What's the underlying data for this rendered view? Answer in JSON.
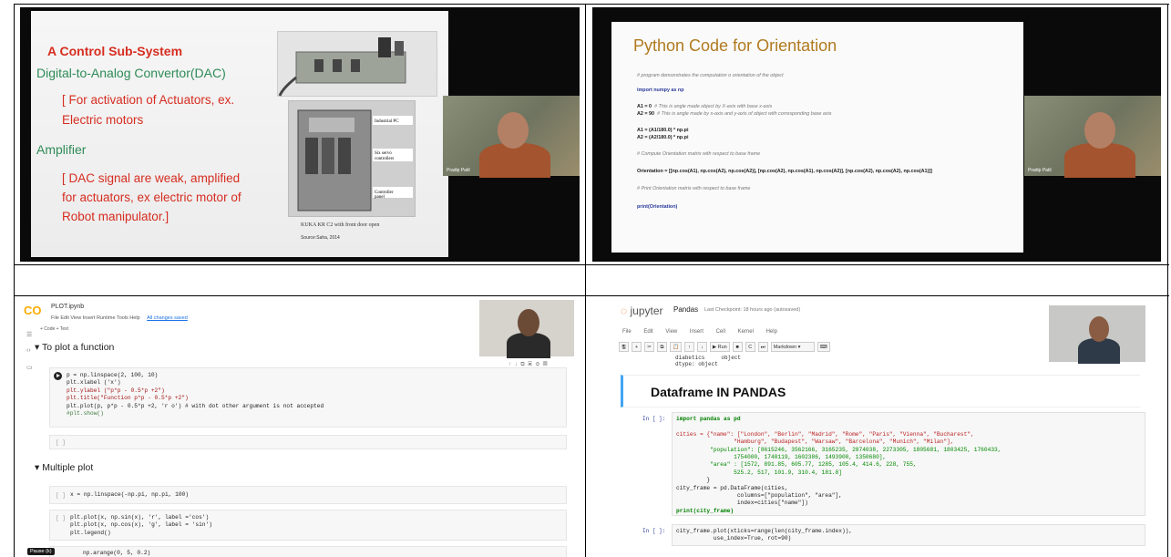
{
  "top_left": {
    "title": "A Control Sub-System",
    "dac_heading": "Digital-to-Analog Convertor(DAC)",
    "dac_bullet_1": "[ For activation of Actuators, ex.",
    "dac_bullet_2": "Electric motors",
    "amp_heading": "Amplifier",
    "amp_bullet_1": "[ DAC signal are weak, amplified",
    "amp_bullet_2": "for actuators, ex electric motor of",
    "amp_bullet_3": "Robot manipulator.]",
    "photo_caption": "KUKA KR C2 with front door open",
    "photo_source": "Source:Saha, 2014",
    "presenter": "Pradip Patil"
  },
  "top_right": {
    "title": "Python Code for Orientation",
    "comment_1": "# program demonstrates the computation o orientation of the object",
    "import_line": "import numpy as np",
    "a1_line": "A1 = 0",
    "a1_comment": "# This is angle  made object by X-axis with base x-axis",
    "a2_line": "A2 = 90",
    "a2_comment": "# This is angle made by x-axis and y-axis of  object with corresponding base axis",
    "a1_conv": "A1 = (A1/180.0) * np.pi",
    "a2_conv": "A2 = (A2/180.0) * np.pi",
    "comment_2": "# Compute Orientation matrix with respect to base frame",
    "orientation_line": "Orientation = [[np.cos(A1), np.cos(A2), np.cos(A2)], [np.cos(A2), np.cos(A1), np.cos(A2)], [np.cos(A2), np.cos(A2), np.cos(A1)]]",
    "comment_3": "# Print Orientation matrix with respect to base frame",
    "print_line": "print(Orientation)",
    "presenter": "Pradip Patil"
  },
  "bottom_left": {
    "logo": "CO",
    "file_name": "PLOT.ipynb",
    "menu": "File  Edit  View  Insert  Runtime  Tools  Help",
    "menu_status": "All changes saved",
    "toolbar": "+ Code   + Text",
    "section_1": "To plot a function",
    "code_1": [
      "p = np.linspace(2, 100, 10)",
      "plt.xlabel ('x')",
      "plt.ylabel (\"p*p - 0.5*p +2\")",
      "plt.title(\"Function p*p - 0.5*p +2\")",
      "plt.plot(p, p*p - 0.5*p +2, 'r o') # with dot other argument is not accepted",
      "#plt.show()"
    ],
    "empty_bracket": "[ ]",
    "section_2": "Multiple plot",
    "code_2": "x = np.linspace(-np.pi, np.pi, 100)",
    "code_3": [
      "plt.plot(x, np.sin(x), 'r', label ='cos')",
      "plt.plot(x, np.cos(x), 'g', label = 'sin')",
      "plt.legend()"
    ],
    "code_4": "np.arange(0, 5, 0.2)",
    "pause_badge": "Pause (k)",
    "cell_tools": "↑ ↓ ⧉ ▣ ⚙ ▤"
  },
  "bottom_right": {
    "logo": "jupyter",
    "notebook_name": "Pandas",
    "checkpoint": "Last Checkpoint: 18 hours ago  (autosaved)",
    "menu": "File  Edit  View  Insert  Cell  Kernel  Help",
    "toolbar_buttons": [
      "🖫",
      "+",
      "✂",
      "⧉",
      "📋",
      "↑",
      "↓",
      "▶ Run",
      "■",
      "C",
      "⏭",
      "Markdown   ▾",
      "⌨"
    ],
    "output_text": "diabetics     object\ndtype: object",
    "md_heading": "Dataframe IN PANDAS",
    "prompt": "In [ ]:",
    "code_1": "import pandas as pd",
    "code_2": [
      "cities = {\"name\": [\"London\", \"Berlin\", \"Madrid\", \"Rome\", \"Paris\", \"Vienna\", \"Bucharest\",",
      "                 \"Hamburg\", \"Budapest\", \"Warsaw\", \"Barcelona\", \"Munich\", \"Milan\"],",
      "          \"population\": [8615246, 3562166, 3165235, 2874038, 2273305, 1805681, 1803425, 1760433,",
      "                 1754000, 1740119, 1602386, 1493900, 1350680],",
      "          \"area\" : [1572, 891.85, 605.77, 1285, 105.4, 414.6, 228, 755,",
      "                 525.2, 517, 101.9, 310.4, 181.8]",
      "         }",
      "city_frame = pd.DataFrame(cities,",
      "                  columns=[\"population\", \"area\"],",
      "                  index=cities[\"name\"])",
      "print(city_frame)"
    ],
    "code_3": [
      "city_frame.plot(xticks=range(len(city_frame.index)),",
      "           use_index=True, rot=90)"
    ]
  }
}
